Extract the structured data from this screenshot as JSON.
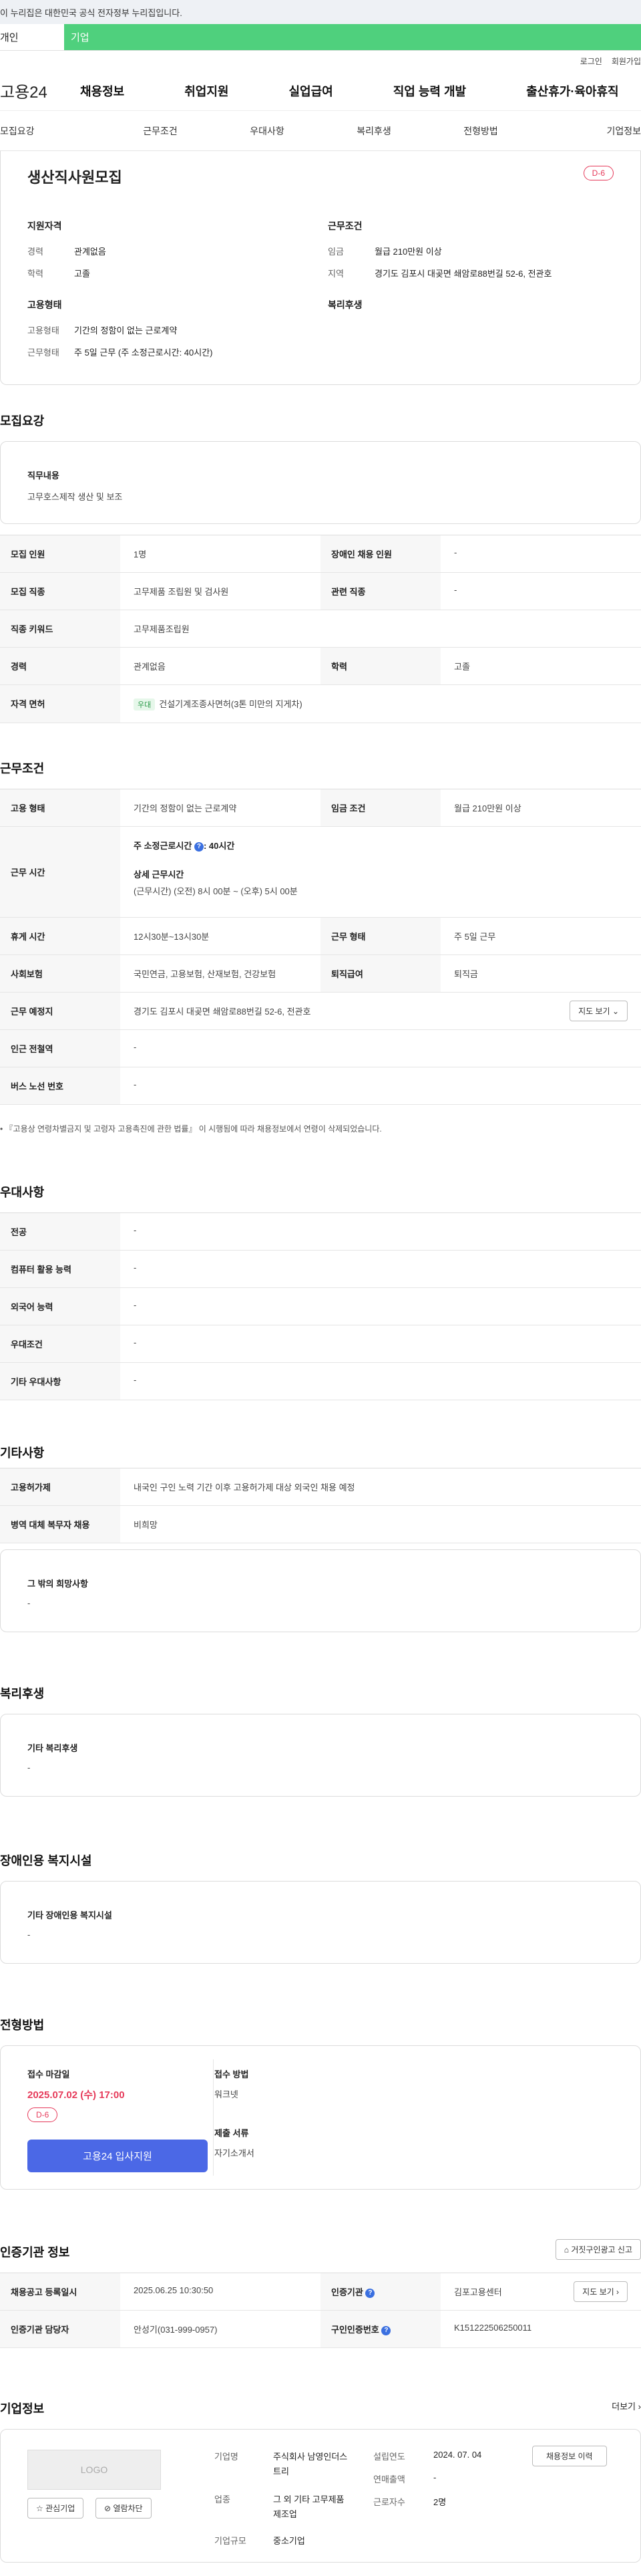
{
  "notice": "이 누리집은 대한민국 공식 전자정부 누리집입니다.",
  "segment": {
    "personal": "개인",
    "company": "기업"
  },
  "util": {
    "login": "로그인",
    "join": "회원가입"
  },
  "logo": "고용24",
  "gnb": [
    "채용정보",
    "취업지원",
    "실업급여",
    "직업 능력 개발",
    "출산휴가·육아휴직"
  ],
  "tabs": [
    "모집요강",
    "근무조건",
    "우대사항",
    "복리후생",
    "전형방법",
    "기업정보"
  ],
  "job": {
    "title": "생산직사원모집",
    "dday": "D-6",
    "qual_title": "지원자격",
    "qual": [
      {
        "k": "경력",
        "v": "관계없음"
      },
      {
        "k": "학력",
        "v": "고졸"
      }
    ],
    "cond_title": "근무조건",
    "cond": [
      {
        "k": "임금",
        "v": "월급 210만원 이상"
      },
      {
        "k": "지역",
        "v": "경기도 김포시 대곶면 쇄암로88번길 52-6, 전관호"
      }
    ],
    "emp_title": "고용형태",
    "emp": [
      {
        "k": "고용형태",
        "v": "기간의 정함이 없는 근로계약"
      },
      {
        "k": "근무형태",
        "v": "주 5일 근무 (주 소정근로시간: 40시간)"
      }
    ],
    "welfare_title": "복리후생"
  },
  "recruit": {
    "title": "모집요강",
    "duty_label": "직무내용",
    "duty": "고무호스제작 생산 및 보조",
    "rows": [
      {
        "th1": "모집 인원",
        "td1": "1명",
        "th2": "장애인 채용 인원",
        "td2": "-"
      },
      {
        "th1": "모집 직종",
        "td1": "고무제품 조립원 및 검사원",
        "th2": "관련 직종",
        "td2": "-"
      },
      {
        "th1": "직종 키워드",
        "td1": "고무제품조립원"
      },
      {
        "th1": "경력",
        "td1": "관계없음",
        "th2": "학력",
        "td2": "고졸"
      },
      {
        "th1": "자격 면허",
        "tag": "우대",
        "td1": "건설기계조종사면허(3톤 미만의 지게차)"
      }
    ]
  },
  "work": {
    "title": "근무조건",
    "emp_type_th": "고용 형태",
    "emp_type": "기간의 정함이 없는 근로계약",
    "wage_th": "임금 조건",
    "wage": "월급 210만원 이상",
    "hours_th": "근무 시간",
    "hours_weekly": "주 소정근로시간",
    "hours_weekly_val": ": 40시간",
    "hours_detail_label": "상세 근무시간",
    "hours_detail": "(근무시간) (오전) 8시 00분 ~ (오후) 5시 00분",
    "break_th": "휴게 시간",
    "break": "12시30분~13시30분",
    "shift_th": "근무 형태",
    "shift": "주 5일 근무",
    "insurance_th": "사회보험",
    "insurance": "국민연금, 고용보험, 산재보험, 건강보험",
    "retire_th": "퇴직급여",
    "retire": "퇴직금",
    "place_th": "근무 예정지",
    "place": "경기도 김포시 대곶면 쇄암로88번길 52-6, 전관호",
    "map_btn": "지도 보기",
    "subway_th": "인근 전철역",
    "subway": "-",
    "bus_th": "버스 노선 번호",
    "bus": "-",
    "note": "『고용상 연령차별금지 및 고령자 고용촉진에 관한 법률』 이 시행됨에 따라 채용정보에서 연령이 삭제되었습니다."
  },
  "pref": {
    "title": "우대사항",
    "rows": [
      {
        "th": "전공",
        "td": "-"
      },
      {
        "th": "컴퓨터 활용 능력",
        "td": "-"
      },
      {
        "th": "외국어 능력",
        "td": "-"
      },
      {
        "th": "우대조건",
        "td": "-"
      },
      {
        "th": "기타 우대사항",
        "td": "-"
      }
    ]
  },
  "etc": {
    "title": "기타사항",
    "rows": [
      {
        "th": "고용허가제",
        "td": "내국인 구인 노력 기간 이후 고용허가제 대상 외국인 채용 예정"
      },
      {
        "th": "병역 대체 복무자 채용",
        "td": "비희망"
      }
    ],
    "other_label": "그 밖의 희망사항",
    "other": "-"
  },
  "welfare": {
    "title": "복리후생",
    "label": "기타 복리후생",
    "value": "-"
  },
  "disabled": {
    "title": "장애인용 복지시설",
    "label": "기타 장애인용 복지시설",
    "value": "-"
  },
  "process": {
    "title": "전형방법",
    "deadline_label": "접수 마감일",
    "deadline": "2025.07.02 (수) 17:00",
    "dday": "D-6",
    "apply_btn": "고용24 입사지원",
    "method_label": "접수 방법",
    "method": "워크넷",
    "docs_label": "제출 서류",
    "docs": "자기소개서"
  },
  "cert": {
    "title": "인증기관 정보",
    "report_btn": "거짓구인광고 신고",
    "reg_th": "채용공고 등록일시",
    "reg": "2025.06.25 10:30:50",
    "agency_th": "인증기관",
    "agency": "김포고용센터",
    "map_btn": "지도 보기",
    "manager_th": "인증기관 담당자",
    "manager": "안성기(031-999-0957)",
    "num_th": "구인인증번호",
    "num": "K151222506250011"
  },
  "company": {
    "title": "기업정보",
    "more": "더보기",
    "logo_text": "LOGO",
    "fav_btn": "관심기업",
    "block_btn": "열람차단",
    "name_k": "기업명",
    "name": "주식회사 남영인더스트리",
    "industry_k": "업종",
    "industry": "그 외 기타 고무제품 제조업",
    "size_k": "기업규모",
    "size": "중소기업",
    "founded_k": "설립연도",
    "founded": "2024. 07. 04",
    "sales_k": "연매출액",
    "sales": "-",
    "emp_k": "근로자수",
    "emp": "2명",
    "history_btn": "채용정보 이력"
  }
}
